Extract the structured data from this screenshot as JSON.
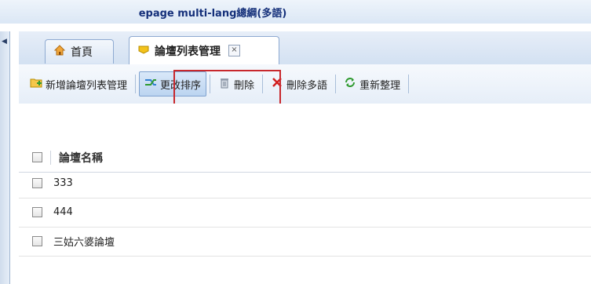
{
  "window": {
    "title": "epage multi-lang總綱(多語)"
  },
  "tabs": [
    {
      "label": "首頁",
      "icon": "home-icon"
    },
    {
      "label": "論壇列表管理",
      "icon": "folder-icon",
      "close": "×"
    }
  ],
  "toolbar": {
    "add_label": "新增論壇列表管理",
    "reorder_label": "更改排序",
    "delete_label": "刪除",
    "delete_multi_label": "刪除多語",
    "reorganize_label": "重新整理"
  },
  "grid": {
    "column_header": "論壇名稱",
    "rows": [
      "333",
      "444",
      "三姑六婆論壇"
    ]
  },
  "colors": {
    "highlight": "#c8282d",
    "delete_x": "#d21f1f",
    "reorg_green": "#2f9a2f"
  }
}
